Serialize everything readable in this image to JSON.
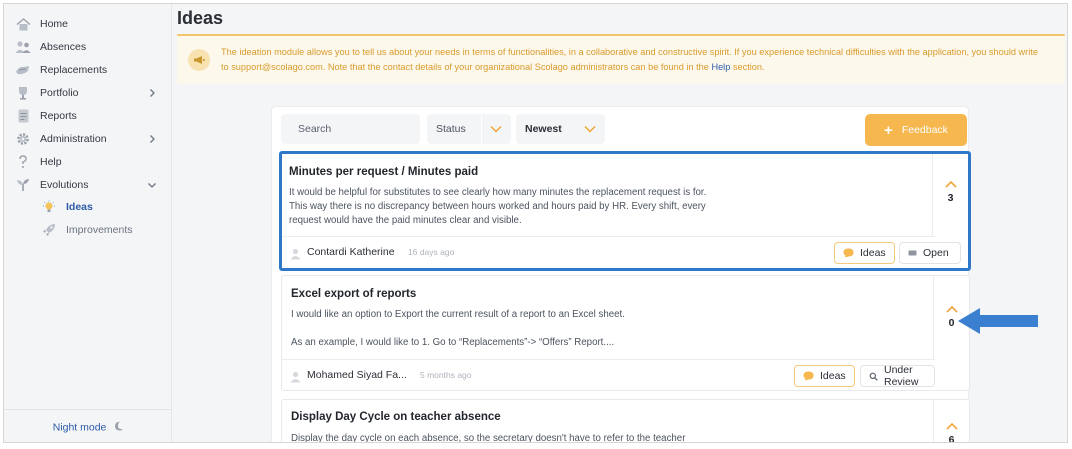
{
  "sidebar": {
    "items": [
      {
        "label": "Home",
        "icon": "home-icon",
        "has_chevron": false
      },
      {
        "label": "Absences",
        "icon": "people-icon",
        "has_chevron": false
      },
      {
        "label": "Replacements",
        "icon": "replacements-icon",
        "has_chevron": false
      },
      {
        "label": "Portfolio",
        "icon": "trophy-icon",
        "has_chevron": true
      },
      {
        "label": "Reports",
        "icon": "report-icon",
        "has_chevron": false
      },
      {
        "label": "Administration",
        "icon": "gear-icon",
        "has_chevron": true
      },
      {
        "label": "Help",
        "icon": "question-icon",
        "has_chevron": false
      },
      {
        "label": "Evolutions",
        "icon": "sprout-icon",
        "has_chevron": true
      }
    ],
    "sub_items": [
      {
        "label": "Ideas",
        "icon": "lightbulb-icon",
        "active": true
      },
      {
        "label": "Improvements",
        "icon": "rocket-icon",
        "active": false
      }
    ],
    "night_mode_label": "Night mode",
    "night_mode_icon": "moon-icon"
  },
  "page": {
    "title": "Ideas",
    "notice": {
      "text_before": "The ideation module allows you to tell us about your needs in terms of functionalities, in a collaborative and constructive spirit. If you experience technical difficulties with the application, you should write to support@scolago.com. Note that the contact details of your organizational Scolago administrators can be found in the",
      "link": "Help",
      "text_after": "section.",
      "icon": "megaphone-icon"
    }
  },
  "toolbar": {
    "search_placeholder": "Search",
    "status_label": "Status",
    "sort_label": "Newest",
    "feedback_label": "Feedback"
  },
  "ideas": [
    {
      "title": "Minutes per request / Minutes paid",
      "description": [
        "It would be helpful for substitutes to see clearly how many minutes the replacement request is for.",
        "This way there is no discrepancy between hours worked and hours paid by HR. Every shift, every",
        "request would have the paid minutes clear and visible."
      ],
      "votes": "3",
      "author": "Contardi Katherine",
      "time": "16 days ago",
      "category": "Ideas",
      "status": "Open"
    },
    {
      "title": "Excel export of reports",
      "description": [
        "I would like an option to Export the current result of a report to an Excel sheet.",
        "",
        "As an example, I would like to 1. Go to “Replacements”-> “Offers” Report...."
      ],
      "votes": "0",
      "author": "Mohamed Siyad Fa...",
      "time": "5 months ago",
      "category": "Ideas",
      "status": "Under Review"
    },
    {
      "title": "Display Day Cycle on teacher absence",
      "description": [
        "Display the day cycle on each absence, so the secretary doesn't have to refer to the teacher"
      ],
      "votes": "6"
    }
  ],
  "colors": {
    "accent_orange": "#f5b74e",
    "link_blue": "#2d5ba8",
    "highlight_blue": "#2e78c7"
  }
}
